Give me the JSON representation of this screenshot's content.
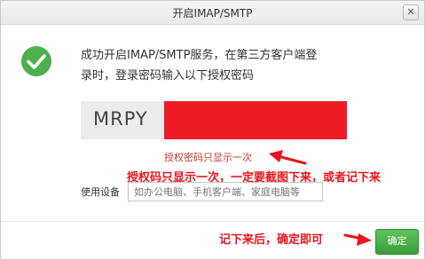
{
  "window": {
    "title": "开启IMAP/SMTP",
    "close_glyph": "✕"
  },
  "message": {
    "line1": "成功开启IMAP/SMTP服务，在第三方客户端登",
    "line2": "录时，登录密码输入以下授权密码"
  },
  "auth_code": {
    "visible_prefix": "MRPY"
  },
  "hint": "授权密码只显示一次",
  "annotations": {
    "note1": "授权码只显示一次，一定要截图下来，或者记下来",
    "note2": "记下来后，确定即可"
  },
  "device": {
    "label": "使用设备",
    "placeholder": "如办公电脑、手机客户端、家庭电脑等",
    "value": ""
  },
  "buttons": {
    "confirm": "确定"
  },
  "colors": {
    "success_green": "#4db04d",
    "annotation_red": "#e8141d",
    "redaction_red": "#ef1b24"
  },
  "icons": {
    "success": "check-circle-icon",
    "close": "close-icon"
  }
}
